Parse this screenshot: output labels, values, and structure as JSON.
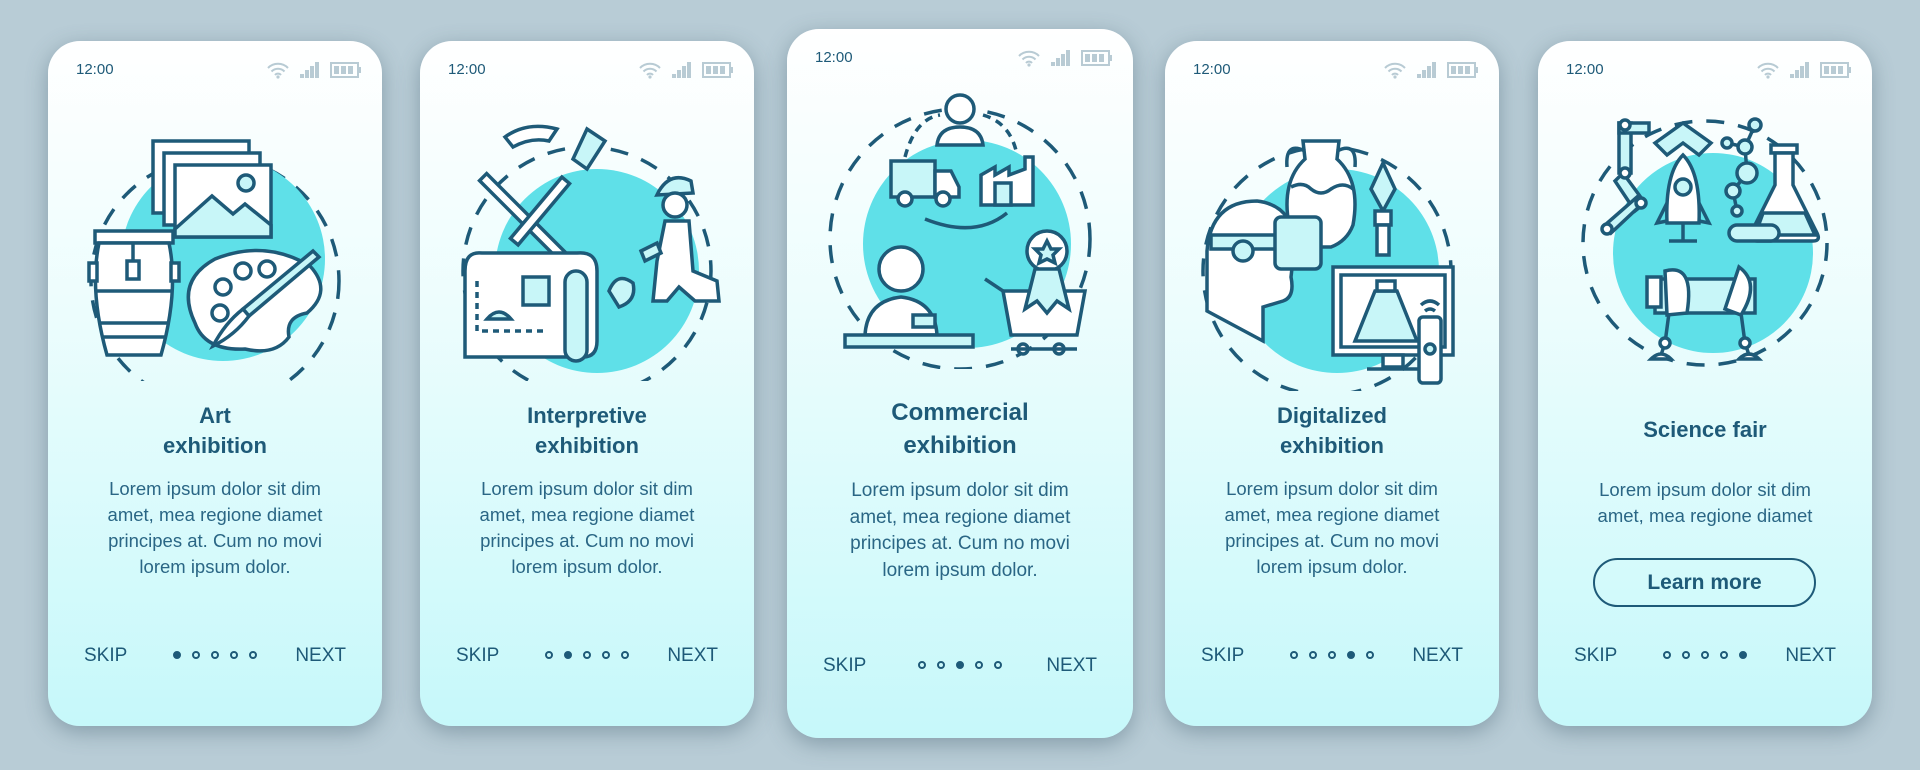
{
  "colors": {
    "background": "#b8ccd6",
    "accent": "#5fe0e8",
    "ink": "#1e5a78",
    "status_icons": "#b8cbd4"
  },
  "status_bar": {
    "time": "12:00",
    "icons": [
      "wifi-icon",
      "signal-icon",
      "battery-icon"
    ]
  },
  "screens": [
    {
      "title_line1": "Art",
      "title_line2": "exhibition",
      "body": [
        "Lorem ipsum dolor sit dim",
        "amet, mea regione diamet",
        "principes at. Cum no movi",
        "lorem ipsum dolor."
      ],
      "illustration": [
        "picture-frames-icon",
        "drum-icon",
        "palette-icon",
        "paintbrush-icon"
      ],
      "active_page": 1
    },
    {
      "title_line1": "Interpretive",
      "title_line2": "exhibition",
      "body": [
        "Lorem ipsum dolor sit dim",
        "amet, mea regione diamet",
        "principes at. Cum no movi",
        "lorem ipsum dolor."
      ],
      "illustration": [
        "pickaxe-icon",
        "brush-icon",
        "treasure-map-icon",
        "archaeologist-icon"
      ],
      "active_page": 2
    },
    {
      "title_line1": "Commercial",
      "title_line2": "exhibition",
      "body": [
        "Lorem ipsum dolor sit dim",
        "amet, mea regione diamet",
        "principes at. Cum no movi",
        "lorem ipsum dolor."
      ],
      "illustration": [
        "customer-icon",
        "truck-icon",
        "factory-icon",
        "seller-icon",
        "award-cart-icon"
      ],
      "active_page": 3
    },
    {
      "title_line1": "Digitalized",
      "title_line2": "exhibition",
      "body": [
        "Lorem ipsum dolor sit dim",
        "amet, mea regione diamet",
        "principes at. Cum no movi",
        "lorem ipsum dolor."
      ],
      "illustration": [
        "vr-headset-icon",
        "amphora-icon",
        "spearhead-icon",
        "monitor-pyramid-icon",
        "remote-icon"
      ],
      "active_page": 4
    },
    {
      "title_line1": "Science fair",
      "title_line2": "",
      "body": [
        "Lorem ipsum dolor sit dim",
        "amet, mea regione diamet"
      ],
      "button": "Learn more",
      "illustration": [
        "robot-arm-icon",
        "rocket-icon",
        "molecule-icon",
        "flask-icon",
        "robot-dog-icon"
      ],
      "active_page": 5
    }
  ],
  "nav": {
    "skip": "SKIP",
    "next": "NEXT",
    "page_count": 5
  }
}
